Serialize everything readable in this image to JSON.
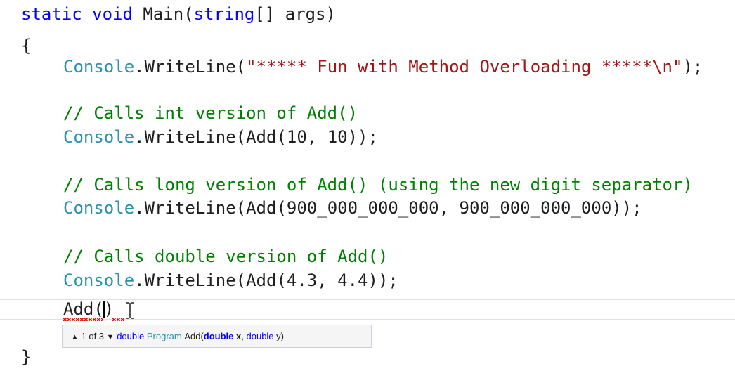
{
  "code": {
    "line1": {
      "static": "static",
      "void": "void",
      "main": " Main(",
      "string": "string",
      "rest": "[] args)"
    },
    "line2": {
      "brace": "{"
    },
    "line3": {
      "console": "Console",
      "call": ".WriteLine(",
      "str": "\"***** Fun with Method Overloading *****\\n\"",
      "end": ");"
    },
    "line4": {
      "comment": "// Calls int version of Add()"
    },
    "line5": {
      "console": "Console",
      "call": ".WriteLine(Add(10, 10));"
    },
    "line6": {
      "comment": "// Calls long version of Add() (using the new digit separator)"
    },
    "line7": {
      "console": "Console",
      "call": ".WriteLine(Add(900_000_000_000, 900_000_000_000));"
    },
    "line8": {
      "comment": "// Calls double version of Add()"
    },
    "line9": {
      "console": "Console",
      "call": ".WriteLine(Add(4.3, 4.4));"
    },
    "line10": {
      "add": "Add(",
      "close": ")"
    },
    "line11": {
      "brace": "}"
    }
  },
  "tooltip": {
    "up_arrow": "▲",
    "counter": "1 of 3",
    "down_arrow": "▼",
    "return_type": "double",
    "class_name": "Program",
    "method": ".Add(",
    "param1_type": "double",
    "param1_name": "x",
    "sep": ", ",
    "param2_type": "double",
    "param2_name": "y",
    "end": ")"
  },
  "colors": {
    "keyword": "#0000ff",
    "type": "#2b91af",
    "string": "#a31515",
    "comment": "#008000",
    "error_squiggle": "#e51400"
  }
}
